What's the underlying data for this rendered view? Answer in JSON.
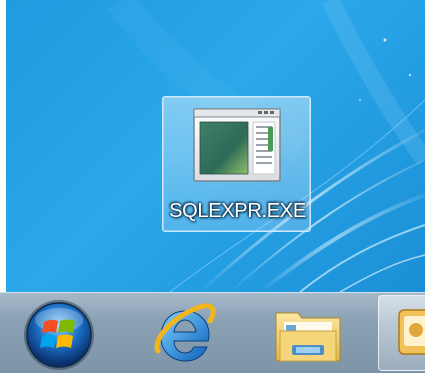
{
  "desktop": {
    "icons": [
      {
        "label": "SQLEXPR.EXE",
        "icon": "application-window-icon"
      }
    ]
  },
  "taskbar": {
    "items": [
      {
        "icon": "windows-start-orb-icon"
      },
      {
        "icon": "internet-explorer-icon"
      },
      {
        "icon": "folder-libraries-icon"
      },
      {
        "icon": "setup-app-icon"
      }
    ]
  },
  "colors": {
    "desktop_blue": "#1f9be0",
    "taskbar": "#8aa1b4",
    "orb_blue": "#1a6fc4"
  }
}
